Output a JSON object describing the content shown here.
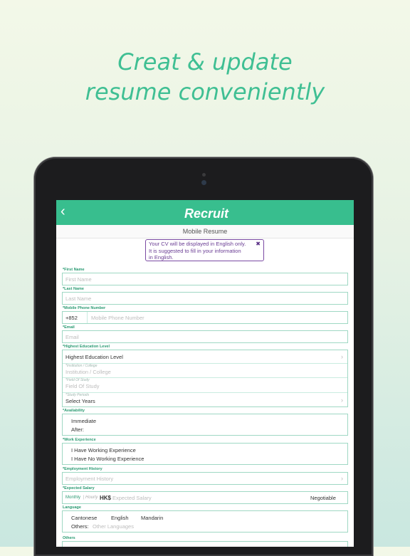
{
  "headline": {
    "line1": "Creat & update",
    "line2": "resume conveniently"
  },
  "nav": {
    "back_icon": "chevron-left-icon",
    "back_glyph": "‹",
    "logo": "Recruit",
    "title": "Mobile Resume"
  },
  "notice": {
    "text1": "Your CV will be displayed in English only.",
    "text2": "It is suggested to fill in your information",
    "text3": "in English.",
    "close": "✖"
  },
  "form": {
    "first_name": {
      "label": "*First Name",
      "placeholder": "First Name"
    },
    "last_name": {
      "label": "*Last Name",
      "placeholder": "Last Name"
    },
    "phone": {
      "label": "*Mobile Phone Number",
      "prefix": "+852",
      "placeholder": "Mobile Phone Number"
    },
    "email": {
      "label": "*Email",
      "placeholder": "Email"
    },
    "education": {
      "label": "*Highest Education Level",
      "value": "Highest Education Level",
      "institution_label": "*Institution / College",
      "institution_placeholder": "Institution / College",
      "field_label": "*Field Of Study",
      "field_placeholder": "Field Of Study",
      "period_label": "*Study Periods",
      "period_value": "Select Years"
    },
    "availability": {
      "label": "*Availability",
      "opt1": "Immediate",
      "opt2": "After:"
    },
    "work_experience": {
      "label": "*Work Experience",
      "opt1": "I Have Working Experience",
      "opt2": "I Have No Working Experience"
    },
    "employment_history": {
      "label": "*Employment History",
      "placeholder": "Employment History"
    },
    "expected_salary": {
      "label": "*Expected Salary",
      "monthly": "Monthly",
      "sep": "|",
      "hourly": "Hourly",
      "currency": "HK$",
      "placeholder": "Expected Salary",
      "negotiable": "Negotiable"
    },
    "language": {
      "label": "Language",
      "opt1": "Cantonese",
      "opt2": "English",
      "opt3": "Mandarin",
      "others_label": "Others:",
      "others_placeholder": "Other Languages"
    },
    "others": {
      "label": "Others"
    }
  },
  "colors": {
    "accent": "#38be8e",
    "notice": "#6a3d94"
  }
}
